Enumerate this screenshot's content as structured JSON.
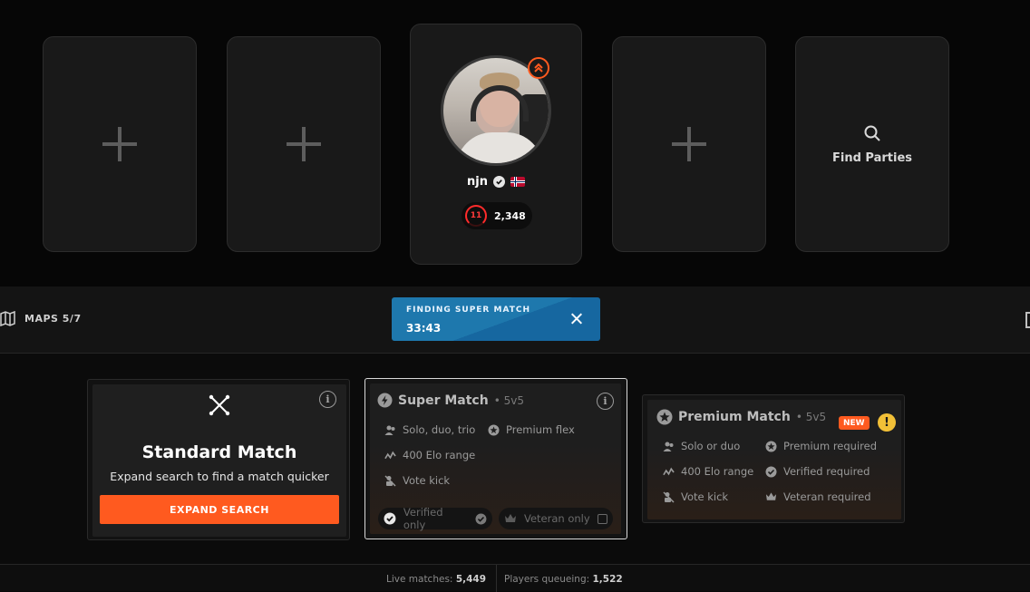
{
  "party": {
    "player": {
      "name": "njn",
      "country": "Norway",
      "level": "11",
      "elo": "2,348"
    },
    "find_parties_label": "Find Parties"
  },
  "queue_bar": {
    "maps_label": "MAPS 5/7",
    "finding_title": "FINDING SUPER MATCH",
    "finding_time": "33:43"
  },
  "matches": {
    "standard": {
      "title": "Standard Match",
      "subtitle": "Expand search to find a match quicker",
      "button_label": "EXPAND SEARCH"
    },
    "super": {
      "title": "Super Match",
      "mode": "• 5v5",
      "features": [
        "Solo, duo, trio",
        "Premium flex",
        "400 Elo range",
        "Vote kick"
      ],
      "toggles": [
        "Verified only",
        "Veteran only"
      ]
    },
    "premium": {
      "title": "Premium Match",
      "mode": "• 5v5",
      "badge": "NEW",
      "features": [
        "Solo or duo",
        "Premium required",
        "400 Elo range",
        "Verified required",
        "Vote kick",
        "Veteran required"
      ]
    }
  },
  "footer": {
    "live_label": "Live matches:",
    "live_value": "5,449",
    "queue_label": "Players queueing:",
    "queue_value": "1,522"
  },
  "colors": {
    "accent": "#ff5a1f",
    "finding_blue": "#1e78ad",
    "level_red": "#ff2b2b",
    "warning_yellow": "#f2c037"
  }
}
